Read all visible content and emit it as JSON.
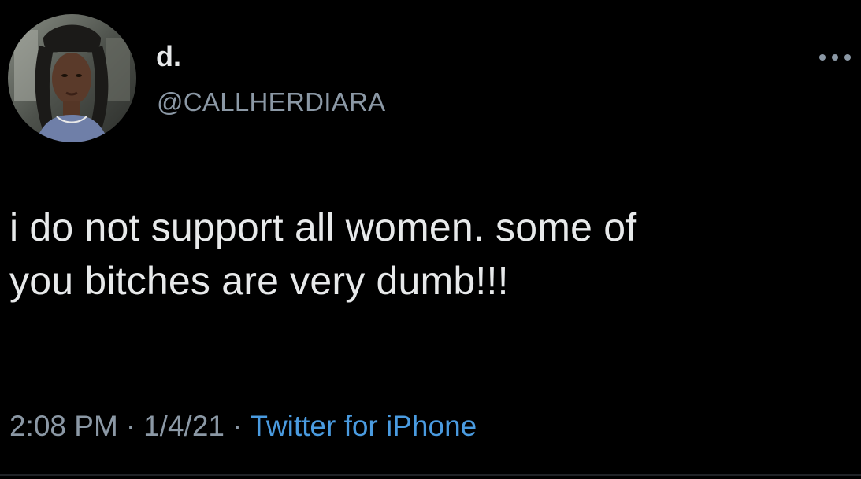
{
  "tweet": {
    "author": {
      "display_name": "d.",
      "handle": "@CALLHERDIARA"
    },
    "text_line_1": "i do not support all women. some of",
    "text_line_2": "you bitches are very dumb!!!",
    "time": "2:08 PM",
    "date": "1/4/21",
    "separator": "·",
    "source": "Twitter for iPhone",
    "icons": {
      "avatar": "profile-photo",
      "more": "more-options-icon"
    },
    "colors": {
      "background": "#000000",
      "primary_text": "#e7e9ea",
      "secondary_text": "#8b98a5",
      "link": "#4a9be0"
    }
  }
}
